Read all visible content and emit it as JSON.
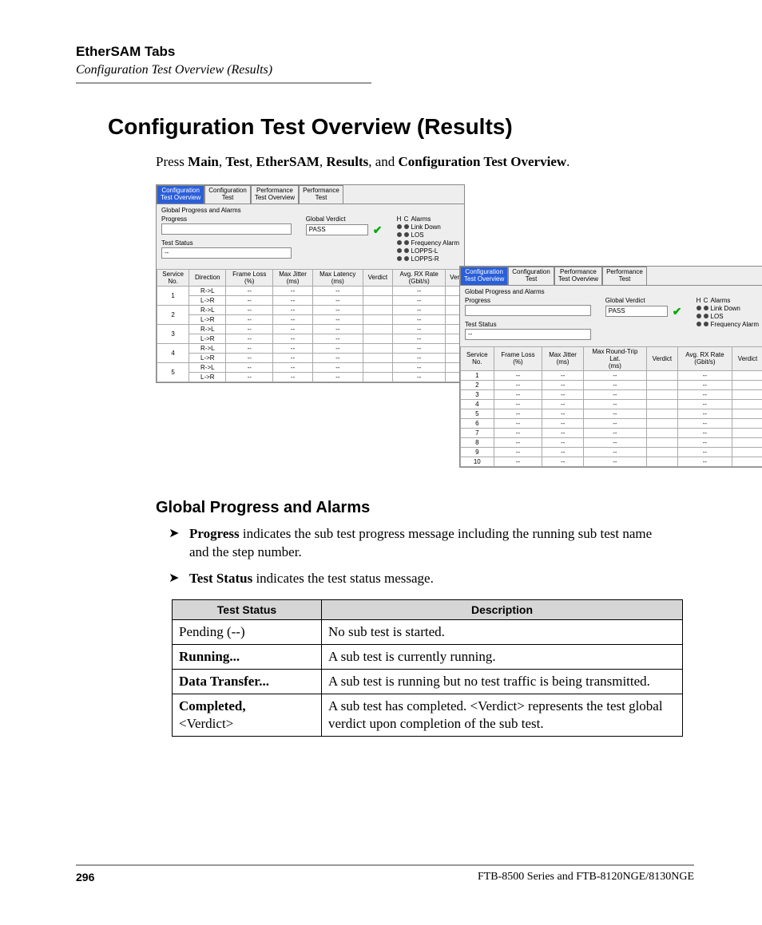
{
  "header": {
    "title": "EtherSAM Tabs",
    "subtitle": "Configuration Test Overview (Results)"
  },
  "main_heading": "Configuration Test Overview (Results)",
  "intro": {
    "pre": "Press ",
    "b1": "Main",
    "c1": ", ",
    "b2": "Test",
    "c2": ", ",
    "b3": "EtherSAM",
    "c3": ", ",
    "b4": "Results",
    "c4": ", and ",
    "b5": "Configuration Test Overview",
    "post": "."
  },
  "screens": {
    "tabs": [
      "Configuration Test Overview",
      "Configuration Test",
      "Performance Test Overview",
      "Performance Test"
    ],
    "panel_title": "Global Progress and Alarms",
    "labels": {
      "progress": "Progress",
      "test_status": "Test Status",
      "global_verdict": "Global Verdict",
      "verdict_value": "PASS",
      "ts_value": "--"
    },
    "alarm_header_a": {
      "h": "H",
      "c": "C",
      "t": "Alarms"
    },
    "alarms_a": [
      "Link Down",
      "LOS",
      "Frequency Alarm",
      "LOPPS-L",
      "LOPPS-R"
    ],
    "alarms_b": [
      "Link Down",
      "LOS",
      "Frequency Alarm"
    ],
    "cols_a": [
      "Service No.",
      "Direction",
      "Frame Loss (%)",
      "Max Jitter (ms)",
      "Max Latency (ms)",
      "Verdict",
      "Avg. RX Rate (Gbit/s)",
      "Ver"
    ],
    "rows_a": [
      {
        "n": "1",
        "d1": "R->L",
        "d2": "L->R"
      },
      {
        "n": "2",
        "d1": "R->L",
        "d2": "L->R"
      },
      {
        "n": "3",
        "d1": "R->L",
        "d2": "L->R"
      },
      {
        "n": "4",
        "d1": "R->L",
        "d2": "L->R"
      },
      {
        "n": "5",
        "d1": "R->L",
        "d2": "L->R"
      }
    ],
    "cols_b": [
      "Service No.",
      "Frame Loss (%)",
      "Max Jitter (ms)",
      "Max Round-Trip Lat. (ms)",
      "Verdict",
      "Avg. RX Rate (Gbit/s)",
      "Verdict"
    ],
    "rows_b": [
      "1",
      "2",
      "3",
      "4",
      "5",
      "6",
      "7",
      "8",
      "9",
      "10"
    ],
    "dash": "--"
  },
  "sub_heading": "Global Progress and Alarms",
  "bullets": [
    {
      "b": "Progress",
      "t": " indicates the sub test progress message including the running sub test name and the step number."
    },
    {
      "b": "Test Status",
      "t": " indicates the test status message."
    }
  ],
  "status_headers": [
    "Test Status",
    "Description"
  ],
  "status_rows": [
    {
      "k": "Pending (--)",
      "kb": false,
      "v": "No sub test is started."
    },
    {
      "k": "Running...",
      "kb": true,
      "v": "A sub test is currently running."
    },
    {
      "k": "Data Transfer...",
      "kb": true,
      "v": "A sub test is running but no test traffic is being transmitted."
    },
    {
      "k": "Completed, <Verdict>",
      "kb": true,
      "v": "A sub test has completed. <Verdict> represents the test global verdict upon completion of the sub test."
    }
  ],
  "footer": {
    "page": "296",
    "model": "FTB-8500 Series and FTB-8120NGE/8130NGE"
  }
}
